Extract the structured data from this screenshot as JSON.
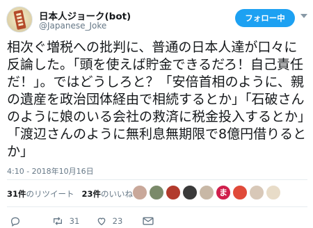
{
  "account": {
    "display_name": "日本人ジョーク(bot)",
    "handle": "@Japanese_Joke",
    "follow_label": "フォロー中"
  },
  "tweet": {
    "text": "相次ぐ増税への批判に、普通の日本人達が口々に反論した。「頭を使えば貯金できるだろ！自己責任だ！」。ではどうしろと？「安倍首相のように、親の遺産を政治団体経由で相続するとか」「石破さんのように娘のいる会社の救済に税金投入するとか」「渡辺さんのように無利息無期限で8億円借りるとか」",
    "timestamp": "4:10 - 2018年10月16日"
  },
  "stats": {
    "retweet_count": "31件",
    "retweet_label": "のリツイート",
    "like_count": "23件",
    "like_label": "のいいね"
  },
  "likers": [
    {
      "icon": "avatar-photo",
      "color": "#c9a89a"
    },
    {
      "icon": "avatar-photo",
      "color": "#7a8a6a"
    },
    {
      "icon": "avatar-photo",
      "color": "#b23a2c"
    },
    {
      "icon": "avatar-photo",
      "color": "#3a3a3a"
    },
    {
      "icon": "avatar-photo",
      "color": "#c8b8a6"
    },
    {
      "icon": "avatar-letter",
      "color": "#d01f4c",
      "letter": "ま"
    },
    {
      "icon": "avatar-photo",
      "color": "#e04a3a"
    },
    {
      "icon": "avatar-photo",
      "color": "#d8c8b8"
    },
    {
      "icon": "avatar-photo",
      "color": "#e8dcc8"
    }
  ],
  "actions": {
    "reply_count": "",
    "retweet_count": "31",
    "like_count": "23",
    "icons": [
      "reply-icon",
      "retweet-icon",
      "like-icon",
      "dm-icon"
    ]
  },
  "colors": {
    "accent": "#1da1f2",
    "muted": "#657786",
    "text": "#14171a"
  }
}
